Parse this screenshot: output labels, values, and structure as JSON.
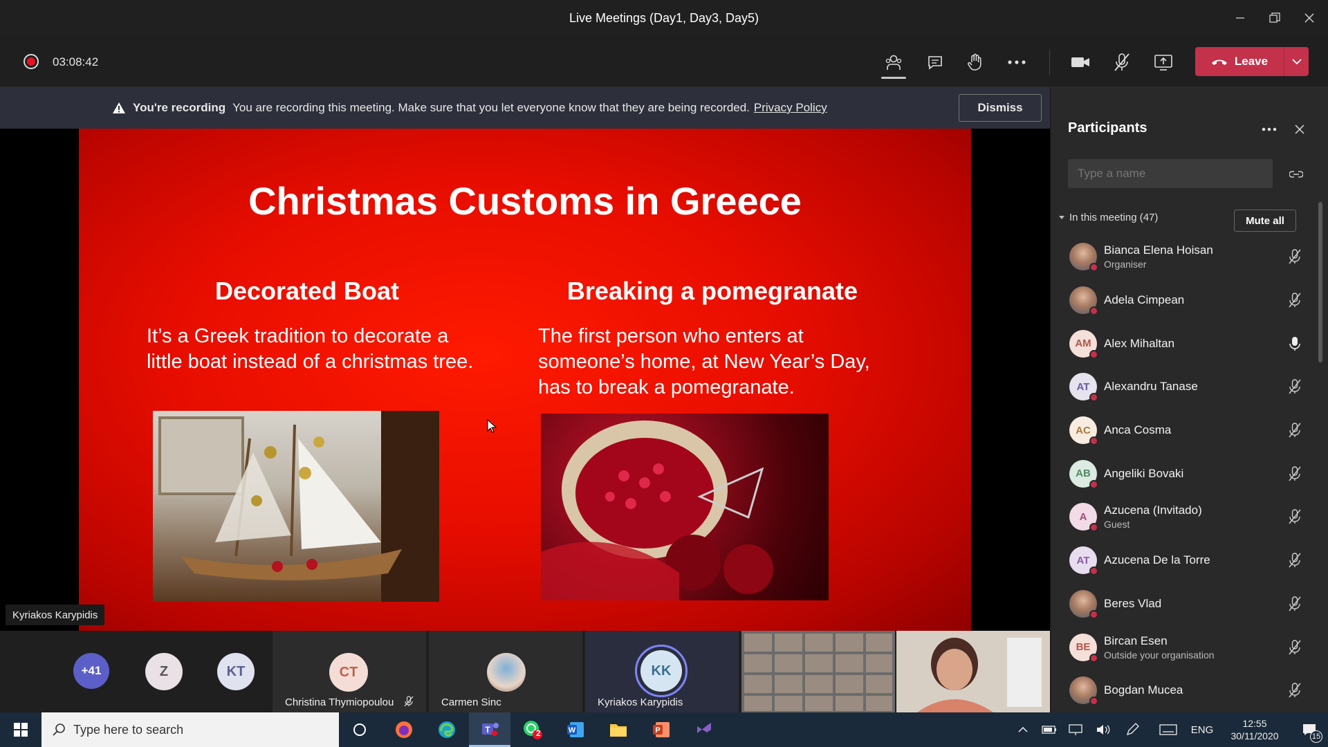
{
  "window": {
    "title": "Live Meetings (Day1, Day3, Day5)"
  },
  "toolbar": {
    "elapsed": "03:08:42",
    "leave_label": "Leave"
  },
  "banner": {
    "bold": "You're recording",
    "text": "You are recording this meeting. Make sure that you let everyone know that they are being recorded.",
    "link": "Privacy Policy",
    "dismiss_label": "Dismiss"
  },
  "slide": {
    "title": "Christmas Customs in Greece",
    "left_heading": "Decorated Boat",
    "left_text_1": "It’s a Greek tradition to decorate a",
    "left_text_2": "little boat instead of a christmas tree.",
    "right_heading": "Breaking a pomegranate",
    "right_text_1": "The first person who enters at",
    "right_text_2": "someone’s home, at New Year’s Day,",
    "right_text_3": "has to break a pomegranate.",
    "speaker": "Kyriakos Karypidis"
  },
  "strip": {
    "overflow": "+41",
    "avatar_z": "Z",
    "avatar_kt": "KT",
    "tile1_initials": "CT",
    "tile1_name": "Christina Thymiopoulou",
    "tile2_name": "Carmen Sinc",
    "tile3_initials": "KK",
    "tile3_name": "Kyriakos Karypidis"
  },
  "panel": {
    "title": "Participants",
    "search_placeholder": "Type a name",
    "section": "In this meeting (47)",
    "mute_all": "Mute all",
    "participants": [
      {
        "name": "Bianca Elena Hoisan",
        "sub": "Organiser",
        "initials": "",
        "photo": true,
        "mic": "muted"
      },
      {
        "name": "Adela Cimpean",
        "sub": "",
        "initials": "",
        "photo": true,
        "mic": "muted"
      },
      {
        "name": "Alex Mihaltan",
        "sub": "",
        "initials": "AM",
        "photo": false,
        "mic": "on"
      },
      {
        "name": "Alexandru Tanase",
        "sub": "",
        "initials": "AT",
        "photo": false,
        "mic": "muted"
      },
      {
        "name": "Anca Cosma",
        "sub": "",
        "initials": "AC",
        "photo": false,
        "mic": "muted"
      },
      {
        "name": "Angeliki Bovaki",
        "sub": "",
        "initials": "AB",
        "photo": false,
        "mic": "muted"
      },
      {
        "name": "Azucena (Invitado)",
        "sub": "Guest",
        "initials": "A",
        "photo": false,
        "mic": "muted"
      },
      {
        "name": "Azucena De la Torre",
        "sub": "",
        "initials": "AT",
        "photo": false,
        "mic": "muted"
      },
      {
        "name": "Beres Vlad",
        "sub": "",
        "initials": "",
        "photo": true,
        "mic": "muted"
      },
      {
        "name": "Bircan Esen",
        "sub": "Outside your organisation",
        "initials": "BE",
        "photo": false,
        "mic": "muted"
      },
      {
        "name": "Bogdan Mucea",
        "sub": "",
        "initials": "",
        "photo": true,
        "mic": "muted"
      }
    ]
  },
  "taskbar": {
    "search_placeholder": "Type here to search",
    "lang": "ENG",
    "time": "12:55",
    "date": "30/11/2020",
    "notif_count": "15",
    "whatsapp_badge": "2"
  },
  "colors": {
    "leave": "#c4314b",
    "accent": "#6264a7",
    "slide_red": "#e60d00"
  }
}
